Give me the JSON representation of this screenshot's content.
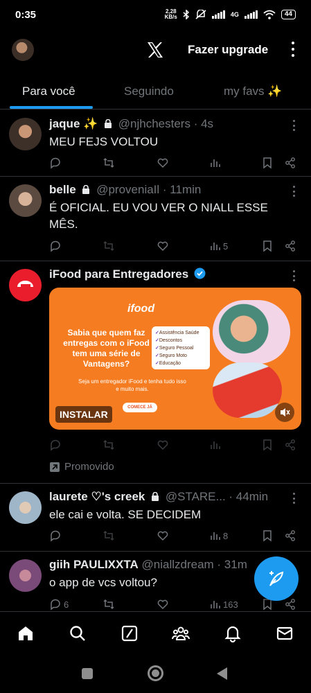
{
  "status": {
    "time": "0:35",
    "net_speed": "2,28",
    "net_unit": "KB/s",
    "network": "4G",
    "battery": "44"
  },
  "header": {
    "upgrade_label": "Fazer upgrade"
  },
  "tabs": [
    {
      "label": "Para você"
    },
    {
      "label": "Seguindo"
    },
    {
      "label": "my favs ✨"
    }
  ],
  "tweets": [
    {
      "name": "jaque ✨",
      "handle": "@njhchesters",
      "time": "· 4s",
      "text": "MEU FEJS VOLTOU",
      "views": ""
    },
    {
      "name": "belle",
      "handle": "@proveniaIl",
      "time": "· 11min",
      "text": "É OFICIAL. EU VOU VER O NIALL ESSE MÊS.",
      "views": "5"
    },
    {
      "name": "laurete ♡'s creek",
      "handle": "@STARE...",
      "time": "· 44min",
      "text": "ele cai e volta. SE DECIDEM",
      "views": "8"
    },
    {
      "name": "giih PAULIXXTA",
      "handle": "@niallzdream",
      "time": "· 31m",
      "text": "o app de vcs voltou?",
      "replies": "6",
      "views": "163"
    }
  ],
  "ad": {
    "advertiser": "iFood para Entregadores",
    "brand": "ifood",
    "headline": "Sabia que quem faz entregas com o iFood tem uma série de Vantagens?",
    "benefits": [
      "Assistência Saúde",
      "Descontos",
      "Seguro Pessoal",
      "Seguro Moto",
      "Educação"
    ],
    "subtext": "Seja um entregador iFood e tenha tudo isso e muito mais.",
    "small_cta": "COMECE JÁ",
    "install_label": "INSTALAR",
    "promoted_label": "Promovido"
  },
  "colors": {
    "accent": "#1d9bf0",
    "background": "#000000",
    "secondary_text": "#71767b",
    "ad_orange": "#f57c20",
    "ifood_red": "#ea1d2c"
  }
}
